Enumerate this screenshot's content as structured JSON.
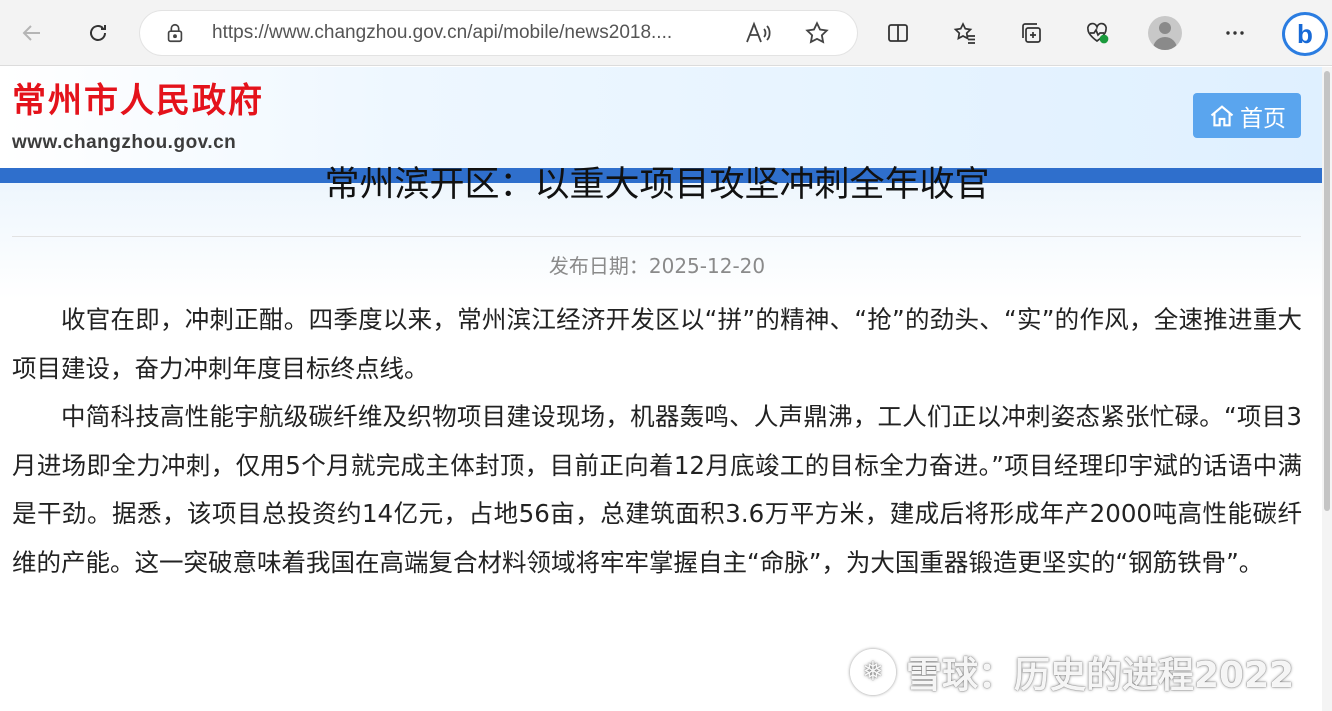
{
  "browser": {
    "url": "https://www.changzhou.gov.cn/api/mobile/news2018...."
  },
  "site": {
    "logo_text": "常州市人民政府",
    "domain": "www.changzhou.gov.cn",
    "home_label": "首页"
  },
  "article": {
    "title": "常州滨开区：以重大项目攻坚冲刺全年收官",
    "date_label": "发布日期：",
    "date": "2025-12-20",
    "paragraphs": [
      "收官在即，冲刺正酣。四季度以来，常州滨江经济开发区以“拼”的精神、“抢”的劲头、“实”的作风，全速推进重大项目建设，奋力冲刺年度目标终点线。",
      "中简科技高性能宇航级碳纤维及织物项目建设现场，机器轰鸣、人声鼎沸，工人们正以冲刺姿态紧张忙碌。“项目3月进场即全力冲刺，仅用5个月就完成主体封顶，目前正向着12月底竣工的目标全力奋进。”项目经理印宇斌的话语中满是干劲。据悉，该项目总投资约14亿元，占地56亩，总建筑面积3.6万平方米，建成后将形成年产2000吨高性能碳纤维的产能。这一突破意味着我国在高端复合材料领域将牢牢掌握自主“命脉”，为大国重器锻造更坚实的“钢筋铁骨”。"
    ]
  },
  "watermark": {
    "logo_glyph": "❅",
    "text": "雪球：历史的进程2022"
  },
  "colors": {
    "logo_red": "#e4121b",
    "nav_blue": "#2f6fcc",
    "home_button": "#5aa5ee"
  }
}
